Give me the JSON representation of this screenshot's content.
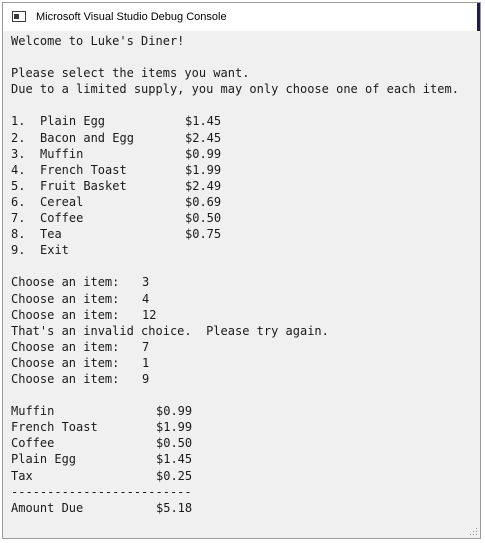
{
  "window": {
    "title": "Microsoft Visual Studio Debug Console"
  },
  "console": {
    "welcome": "Welcome to Luke's Diner!",
    "instructions": [
      "Please select the items you want.",
      "Due to a limited supply, you may only choose one of each item."
    ],
    "menu": [
      {
        "num": "1.",
        "name": "Plain Egg",
        "price": "$1.45"
      },
      {
        "num": "2.",
        "name": "Bacon and Egg",
        "price": "$2.45"
      },
      {
        "num": "3.",
        "name": "Muffin",
        "price": "$0.99"
      },
      {
        "num": "4.",
        "name": "French Toast",
        "price": "$1.99"
      },
      {
        "num": "5.",
        "name": "Fruit Basket",
        "price": "$2.49"
      },
      {
        "num": "6.",
        "name": "Cereal",
        "price": "$0.69"
      },
      {
        "num": "7.",
        "name": "Coffee",
        "price": "$0.50"
      },
      {
        "num": "8.",
        "name": "Tea",
        "price": "$0.75"
      },
      {
        "num": "9.",
        "name": "Exit",
        "price": ""
      }
    ],
    "choose_label": "Choose an item:",
    "choices": [
      "3",
      "4",
      "12"
    ],
    "invalid_msg": "That's an invalid choice.  Please try again.",
    "choices_after": [
      "7",
      "1",
      "9"
    ],
    "summary": [
      {
        "name": "Muffin",
        "price": "$0.99"
      },
      {
        "name": "French Toast",
        "price": "$1.99"
      },
      {
        "name": "Coffee",
        "price": "$0.50"
      },
      {
        "name": "Plain Egg",
        "price": "$1.45"
      },
      {
        "name": "Tax",
        "price": "$0.25"
      }
    ],
    "divider": "-------------------------",
    "amount_due_label": "Amount Due",
    "amount_due_value": "$5.18"
  }
}
